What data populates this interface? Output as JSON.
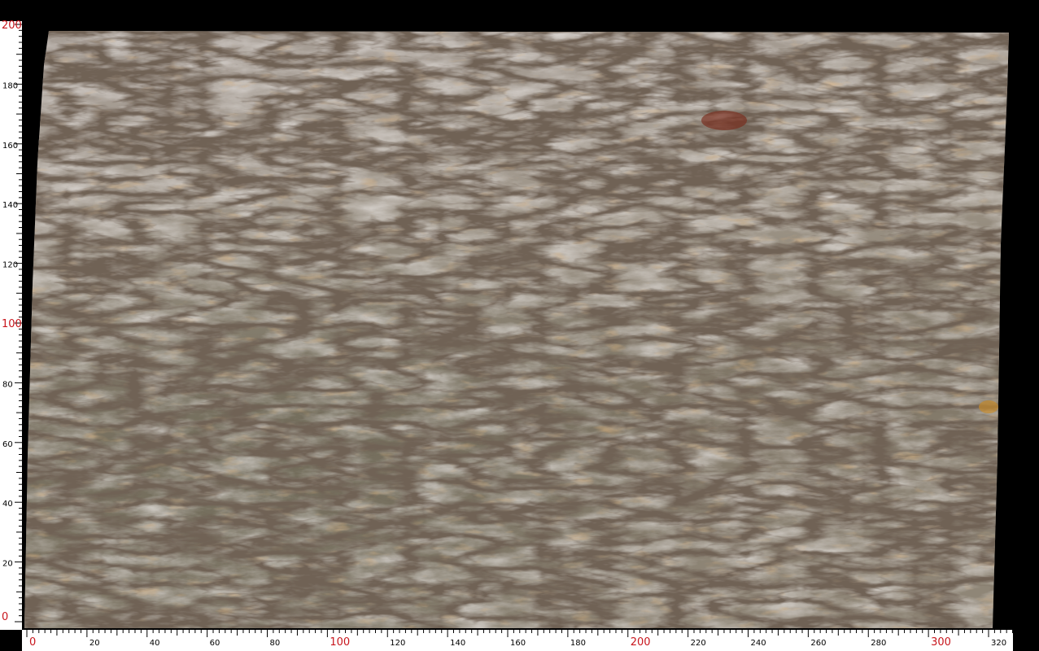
{
  "colors": {
    "background": "#000000",
    "ruler": "#ffffff",
    "tick": "#000000",
    "major_label": "#c8161d",
    "minor_label": "#000000",
    "stone_light": "#cfc8c4",
    "stone_dark": "#8a7f6e",
    "vein": "#2a1f16",
    "rust": "#a8743e"
  },
  "ruler": {
    "left_labels": [
      "0",
      "20",
      "40",
      "60",
      "80",
      "100",
      "120",
      "140",
      "160",
      "180",
      "200"
    ],
    "bottom_labels": [
      "0",
      "20",
      "40",
      "60",
      "80",
      "100",
      "120",
      "140",
      "160",
      "180",
      "200",
      "220",
      "240",
      "260",
      "280",
      "300",
      "320"
    ],
    "major_values": [
      "0",
      "100",
      "200",
      "300"
    ]
  },
  "slab": {
    "description_icon": "marble-slab-texture"
  }
}
